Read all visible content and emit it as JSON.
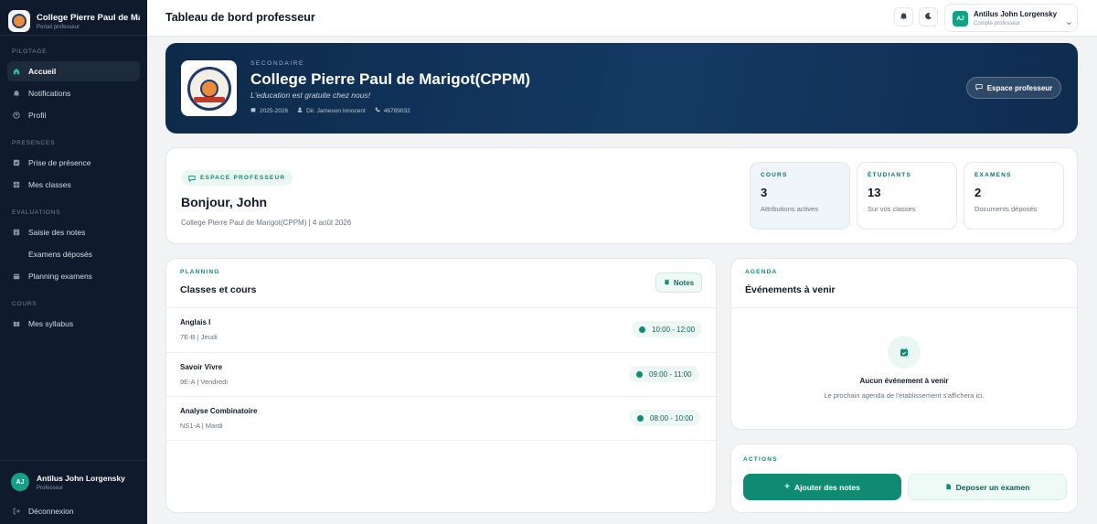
{
  "sidebar": {
    "brand_title": "College Pierre Paul de Ma...",
    "brand_subtitle": "Portail professeur",
    "sections": {
      "pilotage": "PILOTAGE",
      "presences": "PRESENCES",
      "evaluations": "EVALUATIONS",
      "cours": "COURS"
    },
    "items": {
      "accueil": "Accueil",
      "notifications": "Notifications",
      "profil": "Profil",
      "prise_presence": "Prise de présence",
      "mes_classes": "Mes classes",
      "saisie_notes": "Saisie des notes",
      "examens_deposes": "Examens déposés",
      "planning_examens": "Planning examens",
      "mes_syllabus": "Mes syllabus"
    },
    "user": {
      "initials": "AJ",
      "name": "Antilus John Lorgensky",
      "role": "Professeur"
    },
    "logout": "Déconnexion"
  },
  "header": {
    "title": "Tableau de bord professeur",
    "user_initials": "AJ",
    "user_name": "Antilus John Lorgensky",
    "user_role": "Compte professeur"
  },
  "banner": {
    "level": "SECONDAIRE",
    "school_name": "College Pierre Paul de Marigot(CPPM)",
    "motto": "L'education est gratuite chez nous!",
    "year": "2025-2026",
    "director": "Dir. Jameson Innocent",
    "phone": "46789032",
    "button": "Espace professeur"
  },
  "welcome": {
    "tag": "ESPACE PROFESSEUR",
    "greeting": "Bonjour, John",
    "subtitle": "College Pierre Paul de Marigot(CPPM) | 4 août 2026",
    "stats": [
      {
        "label": "COURS",
        "value": "3",
        "sub": "Attributions actives"
      },
      {
        "label": "ÉTUDIANTS",
        "value": "13",
        "sub": "Sur vos classes"
      },
      {
        "label": "EXAMENS",
        "value": "2",
        "sub": "Documents déposés"
      }
    ]
  },
  "planning": {
    "tag": "PLANNING",
    "title": "Classes et cours",
    "button": "Notes",
    "courses": [
      {
        "name": "Anglais I",
        "meta": "7E-B | Jeudi",
        "time": "10:00 - 12:00"
      },
      {
        "name": "Savoir Vivre",
        "meta": "9E-A | Vendredi",
        "time": "09:00 - 11:00"
      },
      {
        "name": "Analyse Combinatoire",
        "meta": "NS1-A | Mardi",
        "time": "08:00 - 10:00"
      }
    ]
  },
  "agenda": {
    "tag": "AGENDA",
    "title": "Événements à venir",
    "empty_title": "Aucun événement à venir",
    "empty_text": "Le prochain agenda de l'établissement s'affichera ici."
  },
  "actions": {
    "tag": "ACTIONS",
    "add_notes": "Ajouter des notes",
    "upload_exam": "Deposer un examen"
  },
  "colors": {
    "sidebar_bg": "#0f1b2d",
    "accent": "#0f8a73",
    "banner_bg": "#143a64"
  }
}
